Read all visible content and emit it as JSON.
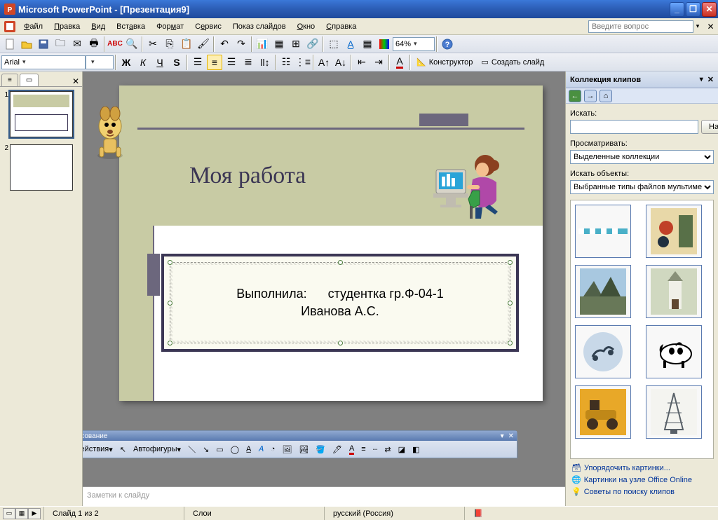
{
  "titlebar": {
    "title": "Microsoft PowerPoint - [Презентация9]"
  },
  "menu": {
    "items": [
      "Файл",
      "Правка",
      "Вид",
      "Вставка",
      "Формат",
      "Сервис",
      "Показ слайдов",
      "Окно",
      "Справка"
    ],
    "askbox_placeholder": "Введите вопрос"
  },
  "toolbar1": {
    "zoom": "64%"
  },
  "toolbar2": {
    "font": "Arial",
    "constructor": "Конструктор",
    "new_slide": "Создать слайд"
  },
  "thumbs": {
    "slides": [
      "1",
      "2"
    ]
  },
  "slide": {
    "title": "Моя работа",
    "line1": "Выполнила:      студентка гр.Ф-04-1",
    "line2": "Иванова А.С."
  },
  "drawbar": {
    "title": "Рисование",
    "actions": "Действия",
    "autoshapes": "Автофигуры"
  },
  "notes": {
    "placeholder": "Заметки к слайду"
  },
  "taskpane": {
    "title": "Коллекция клипов",
    "search_label": "Искать:",
    "search_btn": "Начать",
    "browse_label": "Просматривать:",
    "browse_value": "Выделенные коллекции",
    "objects_label": "Искать объекты:",
    "objects_value": "Выбранные типы файлов мультимед",
    "links": [
      "Упорядочить картинки...",
      "Картинки на узле Office Online",
      "Советы по поиску клипов"
    ]
  },
  "statusbar": {
    "slide_info": "Слайд 1 из 2",
    "layer": "Слои",
    "lang": "русский (Россия)"
  }
}
